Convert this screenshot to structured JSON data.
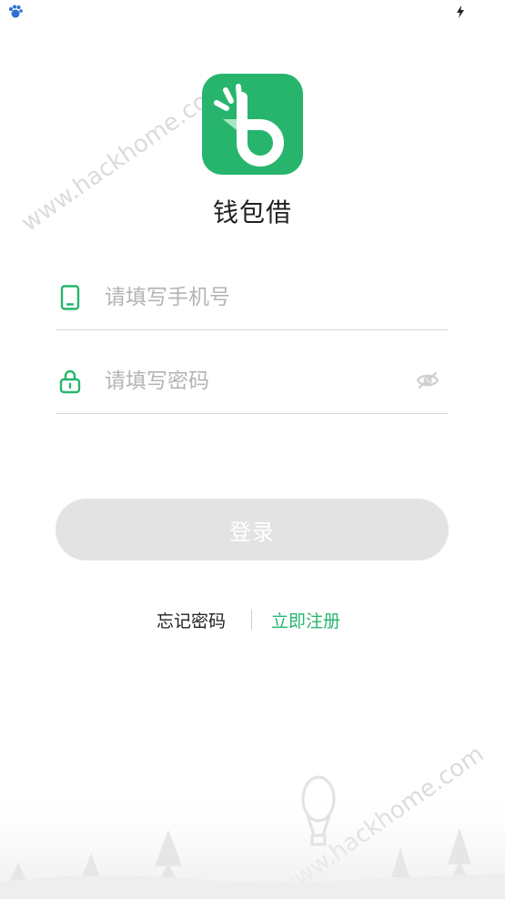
{
  "app": {
    "name": "钱包借"
  },
  "colors": {
    "brand": "#27b56e",
    "button_disabled": "#e3e3e3",
    "divider": "#d6d6d6"
  },
  "form": {
    "phone": {
      "placeholder": "请填写手机号",
      "value": "",
      "icon": "phone-icon"
    },
    "password": {
      "placeholder": "请填写密码",
      "value": "",
      "icon": "lock-icon",
      "toggle_icon": "eye-hidden-icon"
    }
  },
  "login_button": {
    "label": "登录",
    "enabled": false
  },
  "links": {
    "forgot": "忘记密码",
    "register": "立即注册"
  },
  "watermark": {
    "text": "www.hackhome.com"
  }
}
